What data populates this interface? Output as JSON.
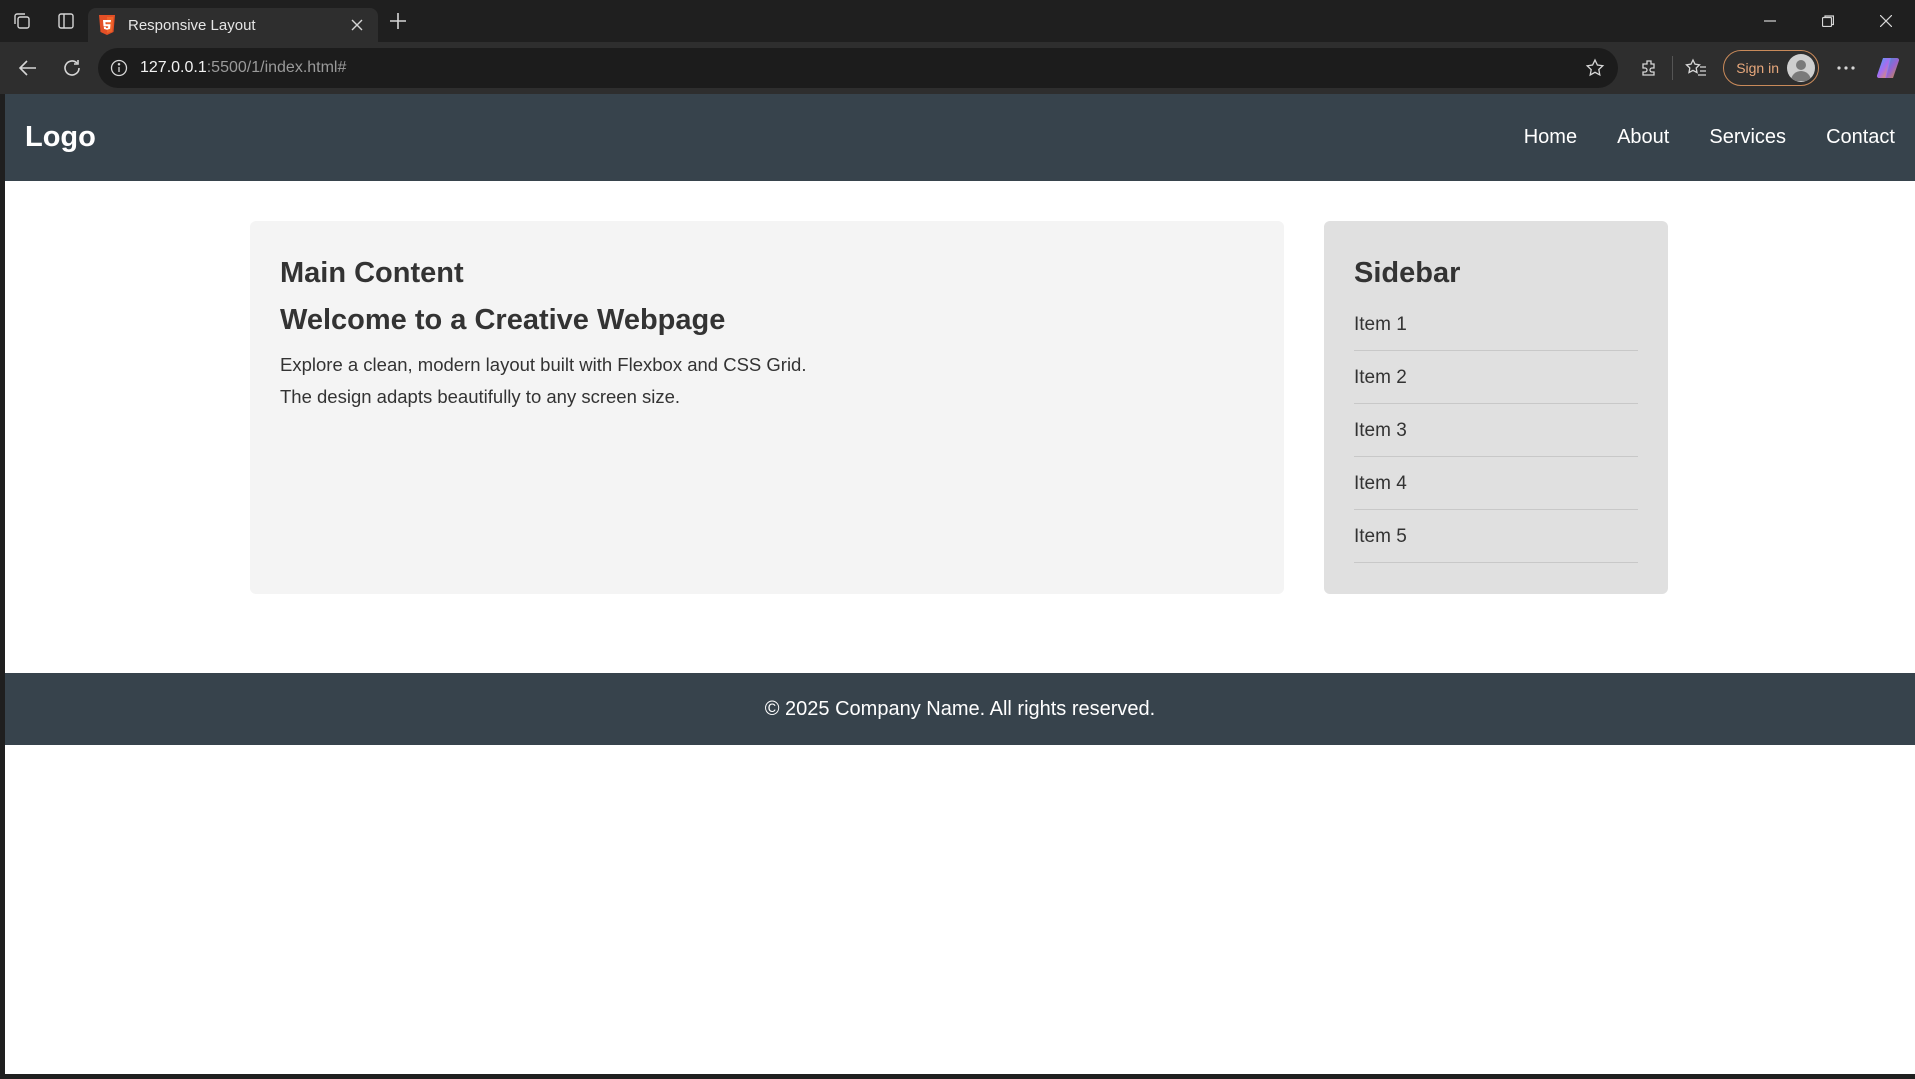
{
  "browser": {
    "tab_title": "Responsive Layout",
    "url_host": "127.0.0.1",
    "url_path": ":5500/1/index.html#",
    "signin_label": "Sign in"
  },
  "site": {
    "logo": "Logo",
    "nav": [
      "Home",
      "About",
      "Services",
      "Contact"
    ],
    "main": {
      "heading": "Main Content",
      "subheading": "Welcome to a Creative Webpage",
      "para1": "Explore a clean, modern layout built with Flexbox and CSS Grid.",
      "para2": "The design adapts beautifully to any screen size."
    },
    "sidebar": {
      "heading": "Sidebar",
      "items": [
        "Item 1",
        "Item 2",
        "Item 3",
        "Item 4",
        "Item 5"
      ]
    },
    "footer": "© 2025 Company Name. All rights reserved."
  }
}
